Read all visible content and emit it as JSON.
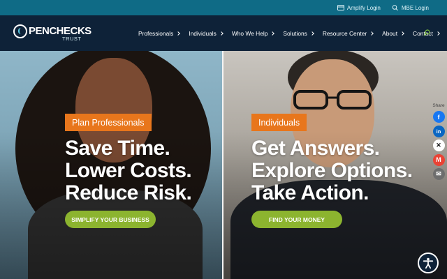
{
  "topbar": {
    "amplify_login": "Amplify Login",
    "mbe_login": "MBE Login"
  },
  "logo": {
    "word": "PENCHECKS",
    "sub": "TRUST"
  },
  "nav": {
    "items": [
      "Professionals",
      "Individuals",
      "Who We Help",
      "Solutions",
      "Resource Center",
      "About",
      "Contact"
    ]
  },
  "hero_left": {
    "tag": "Plan Professionals",
    "line1": "Save Time.",
    "line2": "Lower Costs.",
    "line3": "Reduce Risk.",
    "cta": "SIMPLIFY YOUR BUSINESS"
  },
  "hero_right": {
    "tag": "Individuals",
    "line1": "Get Answers.",
    "line2": "Explore Options.",
    "line3": "Take Action.",
    "cta": "FIND YOUR MONEY"
  },
  "share": {
    "label": "Share",
    "buttons": [
      {
        "icon": "facebook-icon",
        "glyph": "f",
        "color": "#1877f2"
      },
      {
        "icon": "linkedin-icon",
        "glyph": "in",
        "color": "#0a66c2"
      },
      {
        "icon": "x-icon",
        "glyph": "✕",
        "color": "#ffffff"
      },
      {
        "icon": "gmail-icon",
        "glyph": "M",
        "color": "#ea4335"
      },
      {
        "icon": "email-icon",
        "glyph": "✉",
        "color": "#6e6e6e"
      }
    ]
  },
  "colors": {
    "topbar": "#0f6b86",
    "nav": "#0e2238",
    "tag_orange": "#e8761c",
    "cta_green": "#8cb42f"
  }
}
